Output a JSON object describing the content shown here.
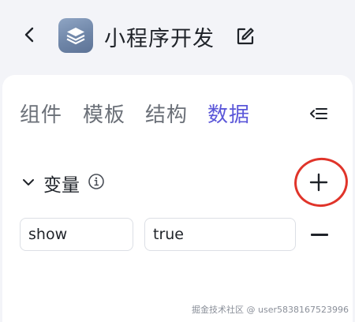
{
  "header": {
    "title": "小程序开发"
  },
  "tabs": [
    {
      "label": "组件",
      "active": false
    },
    {
      "label": "模板",
      "active": false
    },
    {
      "label": "结构",
      "active": false
    },
    {
      "label": "数据",
      "active": true
    }
  ],
  "section": {
    "title": "变量"
  },
  "variables": [
    {
      "name": "show",
      "value": "true"
    }
  ],
  "colors": {
    "accent": "#5b57d9",
    "annotation_circle": "#e0342a",
    "background": "#f3f4f8"
  },
  "watermark": "掘金技术社区 @ user5838167523996"
}
